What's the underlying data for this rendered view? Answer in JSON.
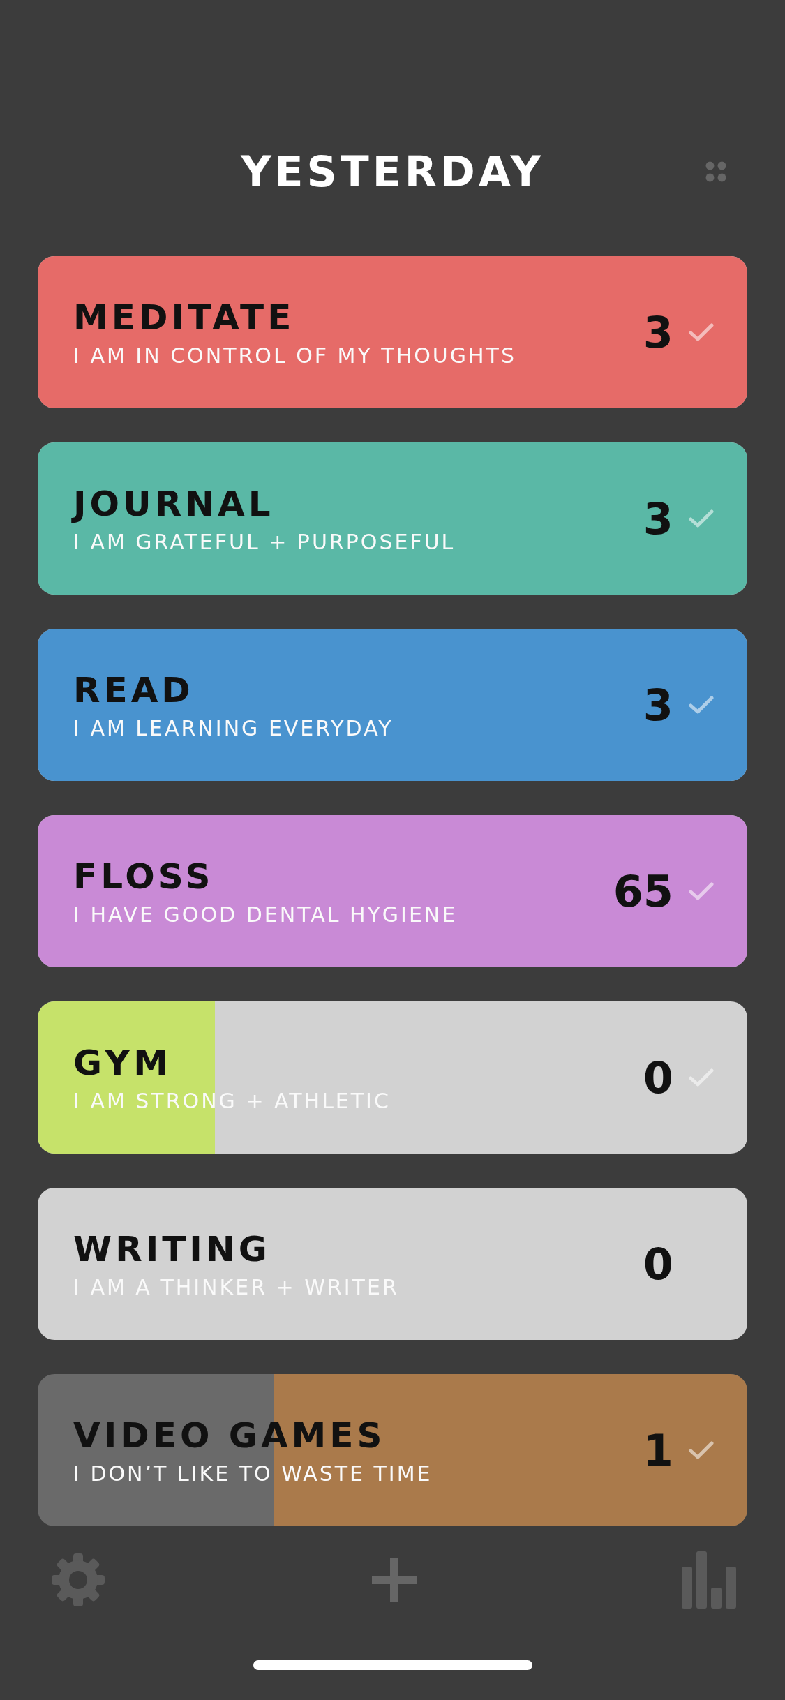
{
  "header": {
    "title": "YESTERDAY"
  },
  "habits": [
    {
      "kind": "good",
      "name": "MEDITATE",
      "affirmation": "I AM IN CONTROL OF MY THOUGHTS",
      "count": "3",
      "level": 1,
      "color": "#e66b68",
      "checkmark": true
    },
    {
      "kind": "good",
      "name": "JOURNAL",
      "affirmation": "I AM GRATEFUL + PURPOSEFUL",
      "count": "3",
      "level": 1,
      "color": "#5ab8a6",
      "checkmark": true
    },
    {
      "kind": "good",
      "name": "READ",
      "affirmation": "I AM LEARNING EVERYDAY",
      "count": "3",
      "level": 1,
      "color": "#4993cf",
      "checkmark": true
    },
    {
      "kind": "good",
      "name": "FLOSS",
      "affirmation": "I HAVE GOOD DENTAL HYGIENE",
      "count": "65",
      "level": 1,
      "color": "#c98ad6",
      "checkmark": true
    },
    {
      "kind": "good",
      "name": "GYM",
      "affirmation": "I AM STRONG + ATHLETIC",
      "count": "0",
      "level": 0.25,
      "color": "#c6e26a",
      "checkmark": true
    },
    {
      "kind": "good",
      "name": "WRITING",
      "affirmation": "I AM A THINKER + WRITER",
      "count": "0",
      "checkmark": false
    },
    {
      "kind": "bad",
      "name": "VIDEO GAMES",
      "affirmation": "I DON’T LIKE TO WASTE TIME",
      "count": "1",
      "level": 0.667,
      "color": "#aa7a4b",
      "checkmark": true
    }
  ]
}
